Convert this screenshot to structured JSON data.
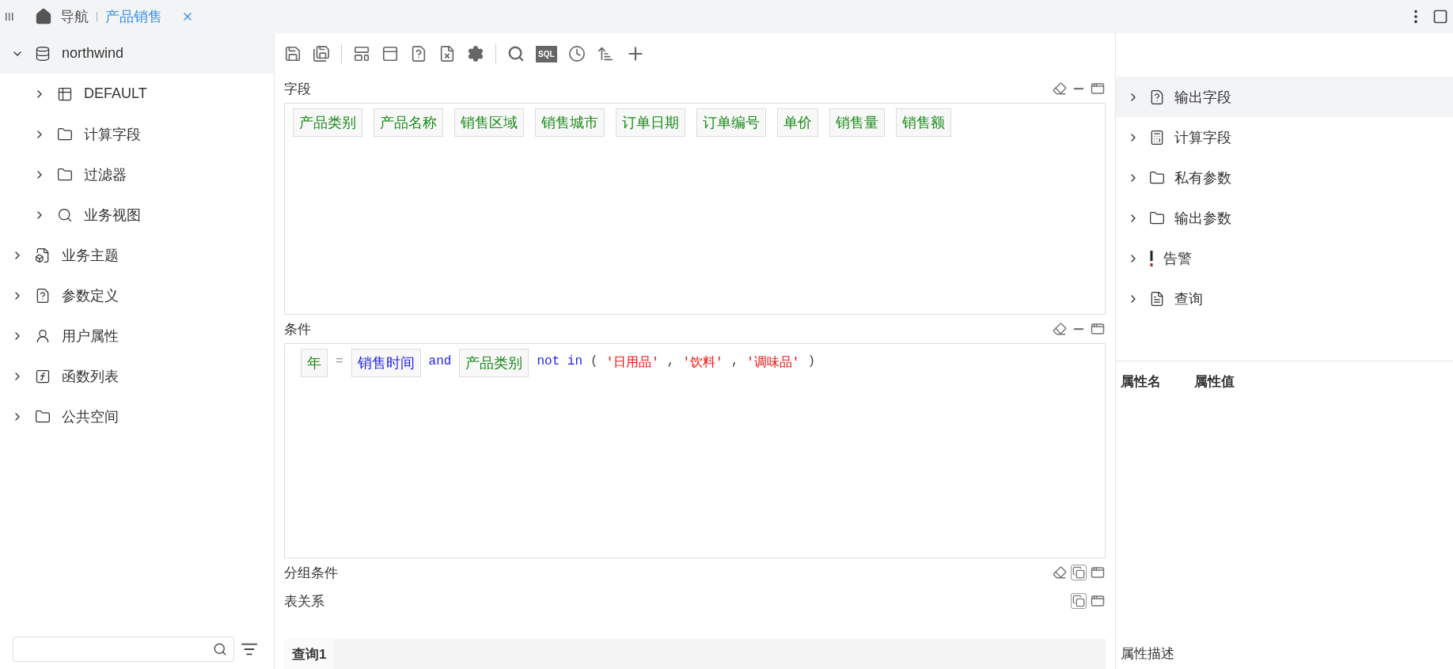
{
  "topbar": {
    "nav_label": "导航",
    "tabs": [
      {
        "label": "产品销售",
        "selected": true
      }
    ]
  },
  "sidebar": {
    "items": [
      {
        "label": "northwind",
        "kind": "database",
        "selected": true,
        "expanded": true,
        "children": [
          {
            "label": "DEFAULT",
            "kind": "table",
            "selected": false,
            "expanded": false
          },
          {
            "label": "计算字段",
            "kind": "folder",
            "selected": false,
            "expanded": false
          },
          {
            "label": "过滤器",
            "kind": "folder",
            "selected": false,
            "expanded": false
          },
          {
            "label": "业务视图",
            "kind": "search",
            "selected": false,
            "expanded": false
          }
        ]
      },
      {
        "label": "业务主题",
        "kind": "subject",
        "selected": false,
        "expanded": false
      },
      {
        "label": "参数定义",
        "kind": "param",
        "selected": false,
        "expanded": false
      },
      {
        "label": "用户属性",
        "kind": "user",
        "selected": false,
        "expanded": false
      },
      {
        "label": "函数列表",
        "kind": "function",
        "selected": false,
        "expanded": false
      },
      {
        "label": "公共空间",
        "kind": "folder",
        "selected": false,
        "expanded": false
      }
    ]
  },
  "toolbar": {
    "sql_label": "SQL"
  },
  "fields_section": {
    "title": "字段",
    "fields": [
      "产品类别",
      "产品名称",
      "销售区域",
      "销售城市",
      "订单日期",
      "订单编号",
      "单价",
      "销售量",
      "销售额"
    ]
  },
  "condition_section": {
    "title": "条件",
    "tokens": [
      {
        "kind": "field",
        "text": "年",
        "color": "#1a8a1a"
      },
      {
        "kind": "operator",
        "text": "="
      },
      {
        "kind": "field",
        "text": "销售时间",
        "color": "#2222ee"
      },
      {
        "kind": "keyword",
        "text": "and"
      },
      {
        "kind": "field",
        "text": "产品类别",
        "color": "#1a8a1a"
      },
      {
        "kind": "keyword",
        "text": "not in"
      },
      {
        "kind": "punct",
        "text": "("
      },
      {
        "kind": "string",
        "text": "'日用品'"
      },
      {
        "kind": "punct",
        "text": ","
      },
      {
        "kind": "string",
        "text": "'饮料'"
      },
      {
        "kind": "punct",
        "text": ","
      },
      {
        "kind": "string",
        "text": "'调味品'"
      },
      {
        "kind": "punct",
        "text": ")"
      }
    ]
  },
  "collapsed_sections": [
    {
      "title": "分组条件",
      "clearable": true
    },
    {
      "title": "表关系",
      "clearable": false
    }
  ],
  "query_tabs": [
    {
      "label": "查询1",
      "selected": true
    }
  ],
  "right_panel": {
    "items": [
      {
        "label": "输出字段",
        "kind": "output-field",
        "selected": true
      },
      {
        "label": "计算字段",
        "kind": "calculator",
        "selected": false
      },
      {
        "label": "私有参数",
        "kind": "folder",
        "selected": false
      },
      {
        "label": "输出参数",
        "kind": "folder",
        "selected": false
      },
      {
        "label": "告警",
        "kind": "alert",
        "selected": false
      },
      {
        "label": "查询",
        "kind": "query",
        "selected": false
      }
    ],
    "property_columns": [
      "属性名",
      "属性值"
    ],
    "description_label": "属性描述"
  }
}
